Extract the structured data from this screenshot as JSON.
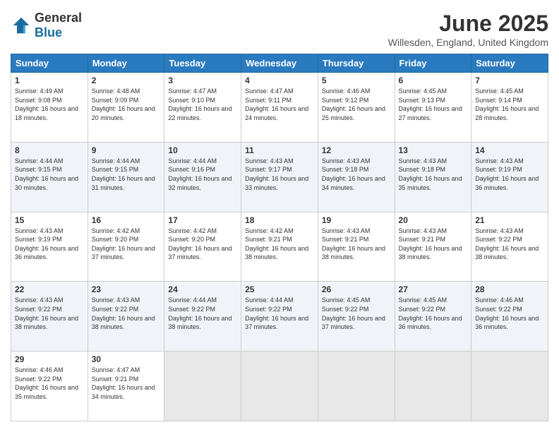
{
  "logo": {
    "general": "General",
    "blue": "Blue"
  },
  "title": "June 2025",
  "subtitle": "Willesden, England, United Kingdom",
  "headers": [
    "Sunday",
    "Monday",
    "Tuesday",
    "Wednesday",
    "Thursday",
    "Friday",
    "Saturday"
  ],
  "weeks": [
    [
      {
        "day": "1",
        "sunrise": "4:49 AM",
        "sunset": "9:08 PM",
        "daylight": "16 hours and 18 minutes."
      },
      {
        "day": "2",
        "sunrise": "4:48 AM",
        "sunset": "9:09 PM",
        "daylight": "16 hours and 20 minutes."
      },
      {
        "day": "3",
        "sunrise": "4:47 AM",
        "sunset": "9:10 PM",
        "daylight": "16 hours and 22 minutes."
      },
      {
        "day": "4",
        "sunrise": "4:47 AM",
        "sunset": "9:11 PM",
        "daylight": "16 hours and 24 minutes."
      },
      {
        "day": "5",
        "sunrise": "4:46 AM",
        "sunset": "9:12 PM",
        "daylight": "16 hours and 25 minutes."
      },
      {
        "day": "6",
        "sunrise": "4:45 AM",
        "sunset": "9:13 PM",
        "daylight": "16 hours and 27 minutes."
      },
      {
        "day": "7",
        "sunrise": "4:45 AM",
        "sunset": "9:14 PM",
        "daylight": "16 hours and 28 minutes."
      }
    ],
    [
      {
        "day": "8",
        "sunrise": "4:44 AM",
        "sunset": "9:15 PM",
        "daylight": "16 hours and 30 minutes."
      },
      {
        "day": "9",
        "sunrise": "4:44 AM",
        "sunset": "9:15 PM",
        "daylight": "16 hours and 31 minutes."
      },
      {
        "day": "10",
        "sunrise": "4:44 AM",
        "sunset": "9:16 PM",
        "daylight": "16 hours and 32 minutes."
      },
      {
        "day": "11",
        "sunrise": "4:43 AM",
        "sunset": "9:17 PM",
        "daylight": "16 hours and 33 minutes."
      },
      {
        "day": "12",
        "sunrise": "4:43 AM",
        "sunset": "9:18 PM",
        "daylight": "16 hours and 34 minutes."
      },
      {
        "day": "13",
        "sunrise": "4:43 AM",
        "sunset": "9:18 PM",
        "daylight": "16 hours and 35 minutes."
      },
      {
        "day": "14",
        "sunrise": "4:43 AM",
        "sunset": "9:19 PM",
        "daylight": "16 hours and 36 minutes."
      }
    ],
    [
      {
        "day": "15",
        "sunrise": "4:43 AM",
        "sunset": "9:19 PM",
        "daylight": "16 hours and 36 minutes."
      },
      {
        "day": "16",
        "sunrise": "4:42 AM",
        "sunset": "9:20 PM",
        "daylight": "16 hours and 37 minutes."
      },
      {
        "day": "17",
        "sunrise": "4:42 AM",
        "sunset": "9:20 PM",
        "daylight": "16 hours and 37 minutes."
      },
      {
        "day": "18",
        "sunrise": "4:42 AM",
        "sunset": "9:21 PM",
        "daylight": "16 hours and 38 minutes."
      },
      {
        "day": "19",
        "sunrise": "4:43 AM",
        "sunset": "9:21 PM",
        "daylight": "16 hours and 38 minutes."
      },
      {
        "day": "20",
        "sunrise": "4:43 AM",
        "sunset": "9:21 PM",
        "daylight": "16 hours and 38 minutes."
      },
      {
        "day": "21",
        "sunrise": "4:43 AM",
        "sunset": "9:22 PM",
        "daylight": "16 hours and 38 minutes."
      }
    ],
    [
      {
        "day": "22",
        "sunrise": "4:43 AM",
        "sunset": "9:22 PM",
        "daylight": "16 hours and 38 minutes."
      },
      {
        "day": "23",
        "sunrise": "4:43 AM",
        "sunset": "9:22 PM",
        "daylight": "16 hours and 38 minutes."
      },
      {
        "day": "24",
        "sunrise": "4:44 AM",
        "sunset": "9:22 PM",
        "daylight": "16 hours and 38 minutes."
      },
      {
        "day": "25",
        "sunrise": "4:44 AM",
        "sunset": "9:22 PM",
        "daylight": "16 hours and 37 minutes."
      },
      {
        "day": "26",
        "sunrise": "4:45 AM",
        "sunset": "9:22 PM",
        "daylight": "16 hours and 37 minutes."
      },
      {
        "day": "27",
        "sunrise": "4:45 AM",
        "sunset": "9:22 PM",
        "daylight": "16 hours and 36 minutes."
      },
      {
        "day": "28",
        "sunrise": "4:46 AM",
        "sunset": "9:22 PM",
        "daylight": "16 hours and 36 minutes."
      }
    ],
    [
      {
        "day": "29",
        "sunrise": "4:46 AM",
        "sunset": "9:22 PM",
        "daylight": "16 hours and 35 minutes."
      },
      {
        "day": "30",
        "sunrise": "4:47 AM",
        "sunset": "9:21 PM",
        "daylight": "16 hours and 34 minutes."
      },
      null,
      null,
      null,
      null,
      null
    ]
  ]
}
